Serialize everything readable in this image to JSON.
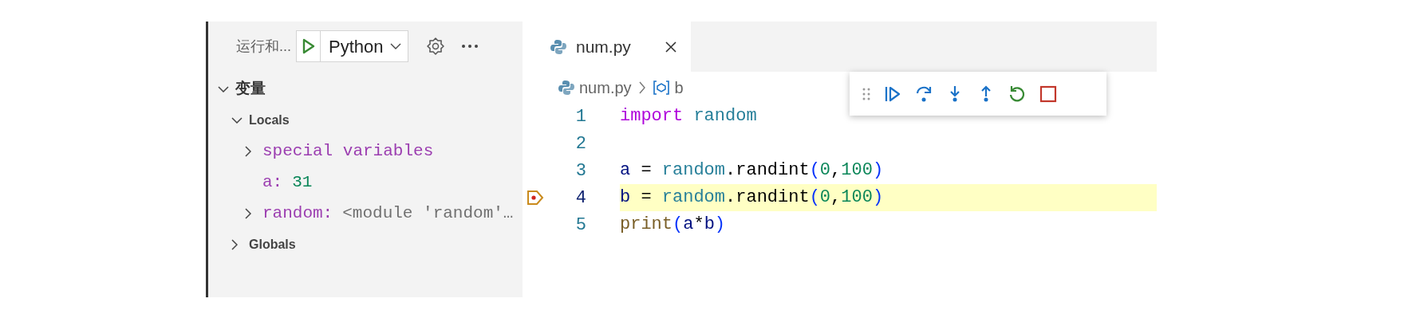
{
  "sidebar": {
    "title": "运行和...",
    "run_config": "Python",
    "tree": [
      {
        "kind": "section",
        "name": "变量",
        "expanded": true,
        "children": [
          {
            "kind": "scope",
            "name": "Locals",
            "expanded": true,
            "children": [
              {
                "kind": "variable",
                "name": "special variables",
                "expanded": false
              },
              {
                "kind": "variable",
                "name": "a:",
                "value": {
                  "text": "31",
                  "kind": "number"
                }
              },
              {
                "kind": "variable",
                "name": "random:",
                "value": {
                  "text": "<module 'random'…",
                  "kind": "object"
                },
                "expanded": false
              }
            ]
          },
          {
            "kind": "scope",
            "name": "Globals",
            "expanded": false
          }
        ]
      }
    ]
  },
  "editor": {
    "tabs": [
      {
        "label": "num.py",
        "selected": true
      }
    ],
    "breadcrumb": [
      {
        "kind": "file",
        "label": "num.py"
      },
      {
        "kind": "variable",
        "label": "b"
      }
    ],
    "lines": [
      {
        "number": "1",
        "current": false,
        "tokens": [
          {
            "text": "import ",
            "kind": "keyword"
          },
          {
            "text": "random",
            "kind": "module"
          }
        ]
      },
      {
        "number": "2",
        "current": false
      },
      {
        "number": "3",
        "current": false,
        "tokens": [
          {
            "text": "a",
            "kind": "var"
          },
          {
            "text": " = ",
            "kind": "plain"
          },
          {
            "text": "random",
            "kind": "module"
          },
          {
            "text": ".randint",
            "kind": "plain"
          },
          {
            "text": "(",
            "kind": "bracket"
          },
          {
            "text": "0",
            "kind": "number"
          },
          {
            "text": ",",
            "kind": "plain"
          },
          {
            "text": "100",
            "kind": "number"
          },
          {
            "text": ")",
            "kind": "bracket"
          }
        ]
      },
      {
        "number": "4",
        "current": true,
        "tokens": [
          {
            "text": "b",
            "kind": "var"
          },
          {
            "text": " = ",
            "kind": "plain"
          },
          {
            "text": "random",
            "kind": "module"
          },
          {
            "text": ".randint",
            "kind": "plain"
          },
          {
            "text": "(",
            "kind": "bracket"
          },
          {
            "text": "0",
            "kind": "number"
          },
          {
            "text": ",",
            "kind": "plain"
          },
          {
            "text": "100",
            "kind": "number"
          },
          {
            "text": ")",
            "kind": "bracket"
          }
        ]
      },
      {
        "number": "5",
        "current": false,
        "tokens": [
          {
            "text": "print",
            "kind": "func"
          },
          {
            "text": "(",
            "kind": "bracket"
          },
          {
            "text": "a",
            "kind": "var"
          },
          {
            "text": "*",
            "kind": "plain"
          },
          {
            "text": "b",
            "kind": "var"
          },
          {
            "text": ")",
            "kind": "bracket"
          }
        ]
      }
    ]
  }
}
